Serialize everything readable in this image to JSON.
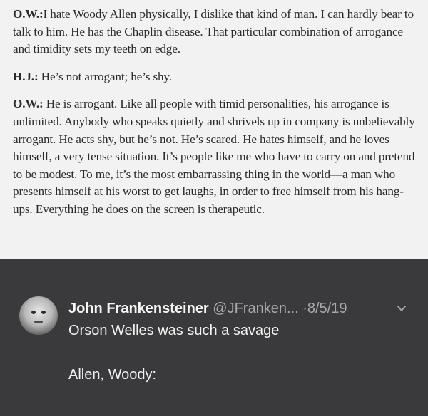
{
  "excerpt": {
    "paragraphs": [
      {
        "speaker": "O.W.:",
        "text": "I hate Woody Allen physically, I dislike that kind of man. I can hardly bear to talk to him. He has the Chaplin disease. That particular combination of arrogance and timidity sets my teeth on edge."
      },
      {
        "speaker": "H.J.:",
        "text": " He’s not arrogant; he’s shy."
      },
      {
        "speaker": "O.W.:",
        "text": " He is arrogant. Like all people with timid personalities, his arrogance is unlimited. Anybody who speaks quietly and shrivels up in company is unbelievably arrogant. He acts shy, but he’s not. He’s scared. He hates himself, and he loves himself, a very tense situation. It’s people like me who have to carry on and pretend to be modest. To me, it’s the most embarrassing thing in the world—a man who presents himself at his worst to get laughs, in order to free himself from his hang-ups. Everything he does on the screen is therapeutic."
      }
    ]
  },
  "tweet": {
    "name": "John Frankensteiner",
    "handle": "@JFranken...",
    "separator": "·",
    "date": "8/5/19",
    "body_line1": "Orson Welles was such a savage",
    "body_line2": "Allen, Woody:",
    "icons": {
      "avatar": "profile-avatar",
      "menu": "chevron-down-icon"
    }
  }
}
